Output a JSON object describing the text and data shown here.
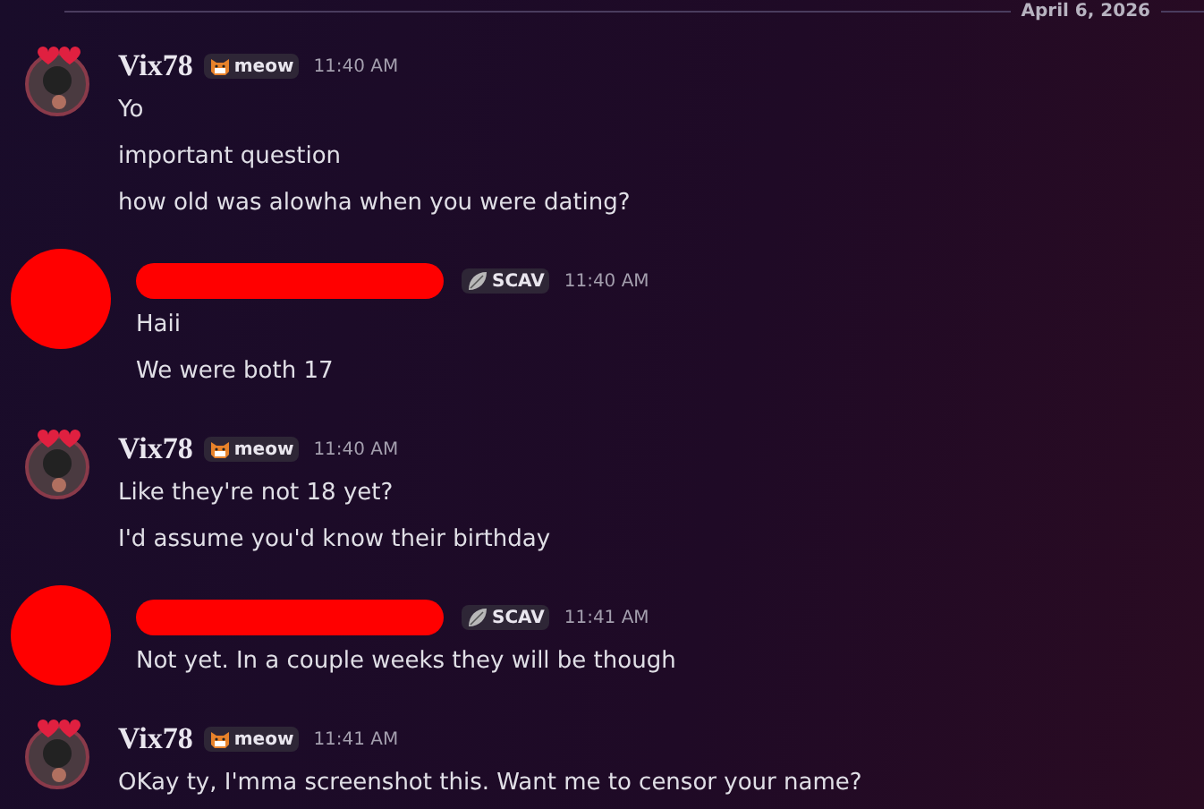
{
  "date_divider": "April 6, 2026",
  "messages": [
    {
      "author": {
        "kind": "user",
        "name": "Vix78"
      },
      "tag": {
        "kind": "cat",
        "label": "meow"
      },
      "time": "11:40 AM",
      "lines": [
        "Yo",
        "important question",
        "how old was alowha when you were dating?"
      ]
    },
    {
      "author": {
        "kind": "redacted"
      },
      "tag": {
        "kind": "leaf",
        "label": "SCAV"
      },
      "time": "11:40 AM",
      "lines": [
        "Haii",
        "We were both 17"
      ]
    },
    {
      "author": {
        "kind": "user",
        "name": "Vix78"
      },
      "tag": {
        "kind": "cat",
        "label": "meow"
      },
      "time": "11:40 AM",
      "lines": [
        "Like they're not 18 yet?",
        "I'd assume you'd know their birthday"
      ]
    },
    {
      "author": {
        "kind": "redacted"
      },
      "tag": {
        "kind": "leaf",
        "label": "SCAV"
      },
      "time": "11:41 AM",
      "lines": [
        "Not yet. In a couple weeks they will be though"
      ]
    },
    {
      "author": {
        "kind": "user",
        "name": "Vix78"
      },
      "tag": {
        "kind": "cat",
        "label": "meow"
      },
      "time": "11:41 AM",
      "lines": [
        "OKay ty, I'mma screenshot this. Want me to censor your name?"
      ]
    }
  ]
}
